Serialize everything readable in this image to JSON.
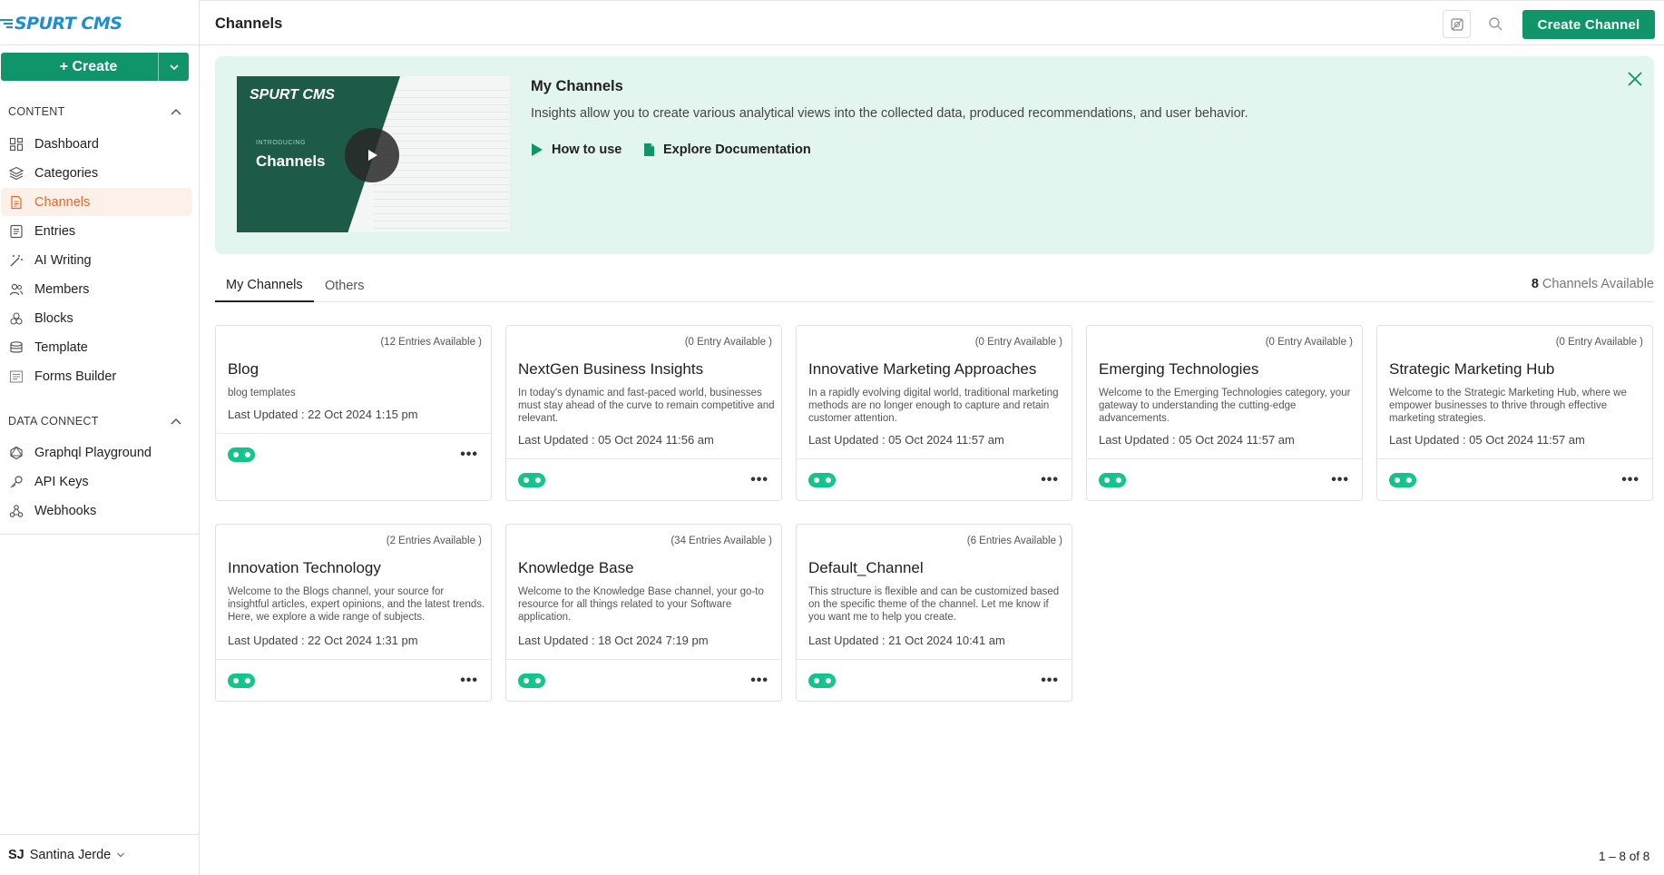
{
  "brand": {
    "name": "SPURT CMS",
    "accent": "#10956a",
    "active": "#e3692c"
  },
  "sidebar": {
    "create_label": "+ Create",
    "sections": [
      {
        "title": "CONTENT",
        "items": [
          {
            "label": "Dashboard",
            "icon": "dashboard-icon"
          },
          {
            "label": "Categories",
            "icon": "layers-icon"
          },
          {
            "label": "Channels",
            "icon": "document-icon",
            "active": true
          },
          {
            "label": "Entries",
            "icon": "entries-icon"
          },
          {
            "label": "AI Writing",
            "icon": "magic-wand-icon"
          },
          {
            "label": "Members",
            "icon": "users-icon"
          },
          {
            "label": "Blocks",
            "icon": "blocks-icon"
          },
          {
            "label": "Template",
            "icon": "template-icon"
          },
          {
            "label": "Forms Builder",
            "icon": "form-icon"
          }
        ]
      },
      {
        "title": "DATA CONNECT",
        "items": [
          {
            "label": "Graphql Playground",
            "icon": "graphql-icon"
          },
          {
            "label": "API Keys",
            "icon": "key-icon"
          },
          {
            "label": "Webhooks",
            "icon": "webhook-icon"
          }
        ]
      }
    ],
    "user": {
      "initials": "SJ",
      "name": "Santina Jerde"
    }
  },
  "header": {
    "title": "Channels",
    "create_channel_label": "Create Channel"
  },
  "banner": {
    "thumb_brand": "SPURT CMS",
    "thumb_intro": "INTRODUCING",
    "thumb_title": "Channels",
    "title": "My Channels",
    "description": "Insights allow you to create various analytical views into the collected data, produced recommendations, and user behavior.",
    "link_how": "How to use",
    "link_docs": "Explore Documentation"
  },
  "tabs": [
    {
      "label": "My Channels",
      "active": true
    },
    {
      "label": "Others",
      "active": false
    }
  ],
  "channels_count": {
    "number": "8",
    "label": "Channels Available"
  },
  "channels": [
    {
      "title": "Blog",
      "entries": "(12 Entries Available )",
      "desc": "blog templates",
      "updated": "Last Updated : 22 Oct 2024 1:15 pm",
      "enabled": true
    },
    {
      "title": "NextGen Business Insights",
      "entries": "(0 Entry Available )",
      "desc": "In today's dynamic and fast-paced world, businesses must stay ahead of the curve to remain competitive and relevant.",
      "updated": "Last Updated : 05 Oct 2024 11:56 am",
      "enabled": true
    },
    {
      "title": "Innovative Marketing Approaches",
      "entries": "(0 Entry Available )",
      "desc": "In a rapidly evolving digital world, traditional marketing methods are no longer enough to capture and retain customer attention.",
      "updated": "Last Updated : 05 Oct 2024 11:57 am",
      "enabled": true
    },
    {
      "title": "Emerging Technologies",
      "entries": "(0 Entry Available )",
      "desc": "Welcome to the Emerging Technologies category, your gateway to understanding the cutting-edge advancements.",
      "updated": "Last Updated : 05 Oct 2024 11:57 am",
      "enabled": true
    },
    {
      "title": "Strategic Marketing Hub",
      "entries": "(0 Entry Available )",
      "desc": "Welcome to the Strategic Marketing Hub, where we empower businesses to thrive through effective marketing strategies.",
      "updated": "Last Updated : 05 Oct 2024 11:57 am",
      "enabled": true
    },
    {
      "title": "Innovation Technology",
      "entries": "(2 Entries Available )",
      "desc": "Welcome to the Blogs channel, your source for insightful articles, expert opinions, and the latest trends. Here, we explore a wide range of subjects.",
      "updated": "Last Updated : 22 Oct 2024 1:31 pm",
      "enabled": true
    },
    {
      "title": "Knowledge Base",
      "entries": "(34 Entries Available )",
      "desc": "Welcome to the Knowledge Base channel, your go-to resource for all things related to your Software application.",
      "updated": "Last Updated : 18 Oct 2024 7:19 pm",
      "enabled": true
    },
    {
      "title": "Default_Channel",
      "entries": "(6 Entries Available )",
      "desc": "This structure is flexible and can be customized based on the specific theme of the channel. Let me know if you want me to help you create.",
      "updated": "Last Updated : 21 Oct 2024 10:41 am",
      "enabled": true
    }
  ],
  "pagination": {
    "label": "1 – 8 of 8"
  }
}
